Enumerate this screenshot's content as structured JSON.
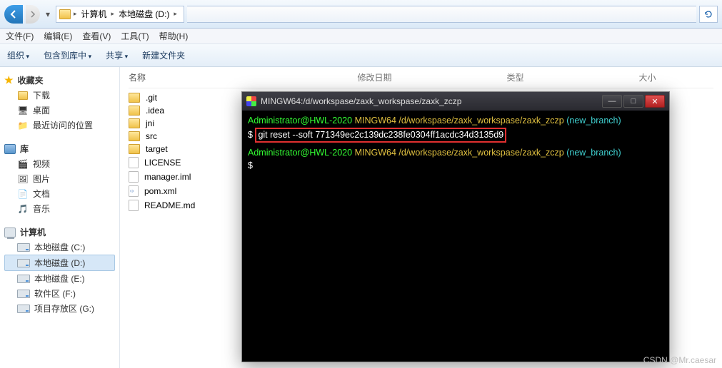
{
  "nav": {
    "seg1": "计算机",
    "seg2": "本地磁盘 (D:)"
  },
  "menu": {
    "file": "文件(F)",
    "edit": "编辑(E)",
    "view": "查看(V)",
    "tools": "工具(T)",
    "help": "帮助(H)"
  },
  "toolbar": {
    "organize": "组织",
    "include": "包含到库中",
    "share": "共享",
    "newfolder": "新建文件夹"
  },
  "sidebar": {
    "fav_head": "收藏夹",
    "fav": [
      "下载",
      "桌面",
      "最近访问的位置"
    ],
    "lib_head": "库",
    "lib": [
      "视频",
      "图片",
      "文档",
      "音乐"
    ],
    "pc_head": "计算机",
    "drives": [
      "本地磁盘 (C:)",
      "本地磁盘 (D:)",
      "本地磁盘 (E:)",
      "软件区 (F:)",
      "项目存放区 (G:)"
    ]
  },
  "cols": {
    "name": "名称",
    "date": "修改日期",
    "type": "类型",
    "size": "大小"
  },
  "files": {
    "folders": [
      ".git",
      ".idea",
      "jni",
      "src",
      "target"
    ],
    "items": [
      "LICENSE",
      "manager.iml",
      "pom.xml",
      "README.md"
    ]
  },
  "term": {
    "title": "MINGW64:/d/workspase/zaxk_workspase/zaxk_zczp",
    "user": "Administrator@HWL-2020",
    "shell": "MINGW64",
    "path": "/d/workspase/zaxk_workspase/zaxk_zczp",
    "branch": "(new_branch)",
    "cmd": "git reset --soft 771349ec2c139dc238fe0304ff1acdc34d3135d9",
    "prompt": "$"
  },
  "watermark": "CSDN @Mr.caesar"
}
